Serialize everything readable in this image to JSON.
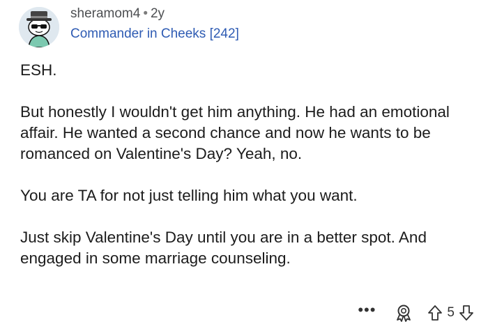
{
  "comment": {
    "username": "sheramom4",
    "separator": "•",
    "age": "2y",
    "flair": "Commander in Cheeks [242]",
    "paragraphs": [
      "ESH.",
      "But honestly I wouldn't get him anything. He had an emotional affair. He wanted a second chance and now he wants to be romanced on Valentine's Day? Yeah, no.",
      "You are TA for not just telling him what you want.",
      "Just skip Valentine's Day until you are in a better spot. And engaged in some marriage counseling."
    ],
    "actions": {
      "more_label": "•••",
      "vote_count": "5"
    }
  },
  "icons": {
    "avatar": "snoo-avatar-icon",
    "award": "award-icon",
    "upvote": "upvote-arrow-icon",
    "downvote": "downvote-arrow-icon"
  },
  "colors": {
    "username": "#4d4f52",
    "flair": "#2e5bb3",
    "text": "#1c1c1c"
  }
}
